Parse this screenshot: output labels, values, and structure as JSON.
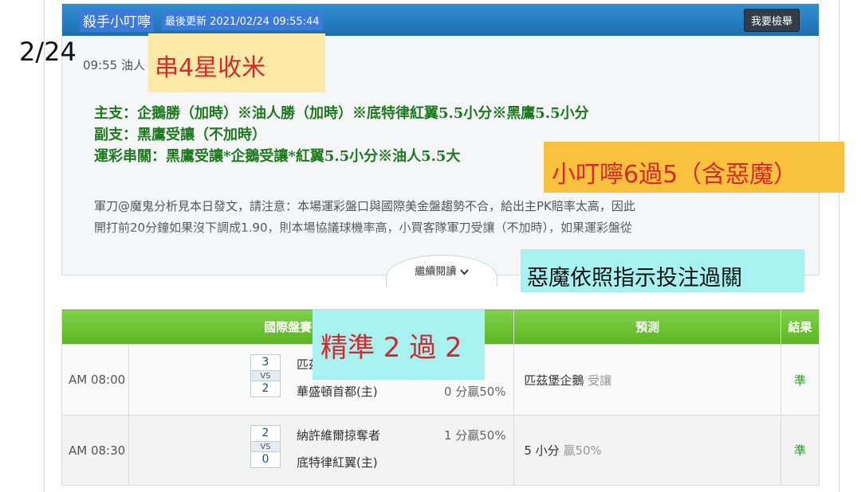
{
  "panel": {
    "author": "殺手小叮嚀",
    "update_label": "最後更新 2021/02/24 09:55:44",
    "report_button": "我要檢舉",
    "intro": "09:55 油人        支持，明天繼續加油",
    "intro_full": "09:55 油人         謝二位支持，明天繼續加油",
    "picks": [
      "主支：企鵝勝（加時）※油人勝（加時）※底特律紅翼5.5小分※黑鷹5.5小分",
      "副支：黑鷹受讓（不加時）",
      "運彩串關：黑鷹受讓*企鵝受讓*紅翼5.5小分※油人5.5大"
    ],
    "analysis": [
      "軍刀@魔鬼分析見本日發文，請注意：本場運彩盤口與國際美金盤趨勢不合，給出主PK賠率太高，因此",
      "開打前20分鐘如果沒下調成1.90，則本場協議球機率高，小買客隊軍刀受讓（不加時），如果運彩盤從"
    ],
    "read_more": "繼續閱讀"
  },
  "table": {
    "headers": {
      "game": "國際盤賽",
      "prediction": "預測",
      "result": "結果"
    },
    "rows": [
      {
        "time": "AM 08:00",
        "score_top": "3",
        "vs": "VS",
        "score_bottom": "2",
        "team_top": "匹茲堡企鵝",
        "team_bottom": "華盛頓首都(主)",
        "line": "0 分贏50%",
        "pred_team": "匹茲堡企鵝",
        "pred_note": "受讓",
        "result": "準"
      },
      {
        "time": "AM 08:30",
        "score_top": "2",
        "vs": "VS",
        "score_bottom": "0",
        "team_top": "納許維爾掠奪者",
        "team_bottom": "底特律紅翼(主)",
        "line": "1 分贏50%",
        "pred_team": "5 小分",
        "pred_note": "贏50%",
        "result": "準"
      }
    ]
  },
  "overlays": {
    "date": "2/24",
    "combo": "串4星收米",
    "six": "小叮嚀6過5（含惡魔）",
    "devil": "惡魔依照指示投注過關",
    "accuracy": "精準 2 過 2"
  }
}
